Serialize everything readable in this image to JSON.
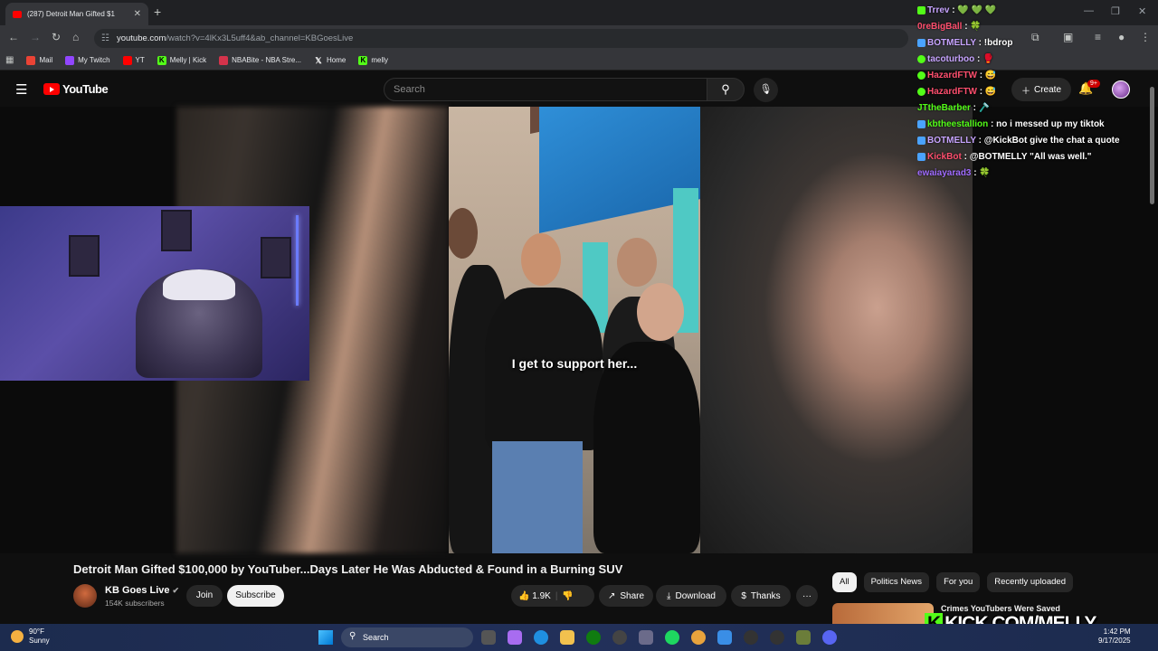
{
  "browser": {
    "tab_title": "(287) Detroit Man Gifted $1",
    "new_tab": "+",
    "url_host": "youtube.com",
    "url_rest": "/watch?v=4lKx3L5uff4&ab_channel=KBGoesLive"
  },
  "bookmarks": [
    {
      "label": "Mail",
      "icon": "gmail-icon",
      "color": "#ea4335"
    },
    {
      "label": "My Twitch",
      "icon": "twitch-icon",
      "color": "#9146ff"
    },
    {
      "label": "YT",
      "icon": "youtube-icon",
      "color": "#ff0000"
    },
    {
      "label": "Melly | Kick",
      "icon": "kick-icon",
      "color": "#53fc18"
    },
    {
      "label": "NBABite - NBA Stre...",
      "icon": "nbabite-icon",
      "color": "#d4334b"
    },
    {
      "label": "Home",
      "icon": "x-icon",
      "color": "#ffffff"
    },
    {
      "label": "melly",
      "icon": "kick-icon",
      "color": "#53fc18"
    }
  ],
  "youtube": {
    "logo": "YouTube",
    "search_placeholder": "Search",
    "create_label": "Create",
    "notifications": "9+"
  },
  "video": {
    "caption": "I get to support her..."
  },
  "chat": [
    {
      "user": "Trrev",
      "color": "#c7a4ff",
      "message": "💚 💚 💚"
    },
    {
      "user": "0reBigBall",
      "color": "#ff4f6e",
      "message": "🍀"
    },
    {
      "user": "BOTMELLY",
      "color": "#c7a4ff",
      "message": "!bdrop"
    },
    {
      "user": "tacoturboo",
      "color": "#c7a4ff",
      "message": "🥊"
    },
    {
      "user": "HazardFTW",
      "color": "#ff4f6e",
      "message": "😅"
    },
    {
      "user": "HazardFTW",
      "color": "#ff4f6e",
      "message": "😅"
    },
    {
      "user": "JTtheBarber",
      "color": "#53fc18",
      "message": "🪒"
    },
    {
      "user": "kbtheestallion",
      "color": "#53fc18",
      "message": "no i messed up my tiktok"
    },
    {
      "user": "BOTMELLY",
      "color": "#c7a4ff",
      "message": "@KickBot give the chat a quote"
    },
    {
      "user": "KickBot",
      "color": "#ff4f6e",
      "message": "@BOTMELLY \"All was well.\""
    },
    {
      "user": "ewaiayarad3",
      "color": "#a06cff",
      "message": "🍀"
    }
  ],
  "watch": {
    "title": "Detroit Man Gifted $100,000 by YouTuber...Days Later He Was Abducted & Found in a Burning SUV",
    "channel": "KB Goes Live",
    "subscribers": "154K subscribers",
    "join": "Join",
    "subscribe": "Subscribe",
    "likes": "1.9K",
    "share": "Share",
    "download": "Download",
    "thanks": "Thanks",
    "more": "···"
  },
  "filters": [
    "All",
    "Politics News",
    "For you",
    "Recently uploaded"
  ],
  "recommended_title": "Crimes YouTubers Were Saved",
  "overlay_banner": "KICK.COM/MELLY",
  "taskbar": {
    "temp": "90°F",
    "condition": "Sunny",
    "search": "Search",
    "time": "1:42 PM",
    "date": "9/17/2025"
  }
}
